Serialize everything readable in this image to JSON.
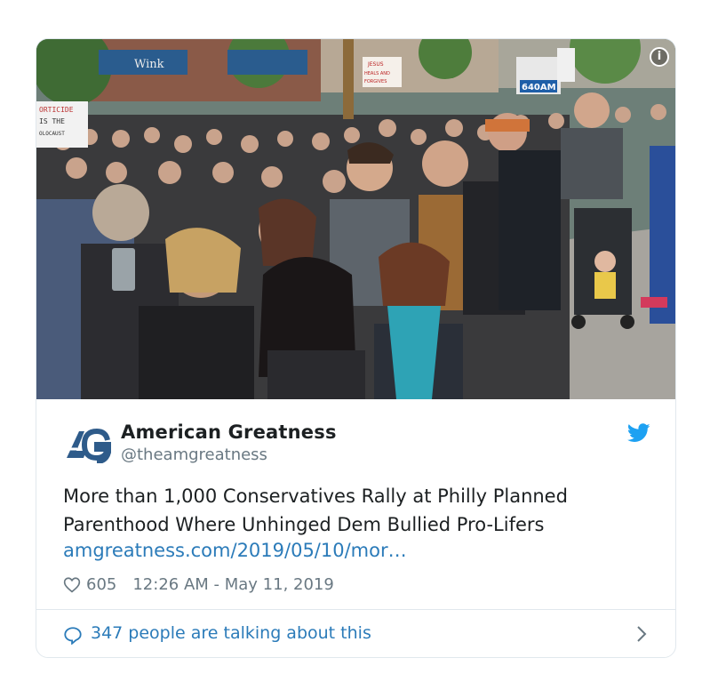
{
  "tweet": {
    "author_name": "American Greatness",
    "handle": "@theamgreatness",
    "text": "More than 1,000 Conservatives Rally at Philly Planned Parenthood Where Unhinged Dem Bullied Pro-Lifers",
    "link": "amgreatness.com/2019/05/10/mor…",
    "likes": "605",
    "timestamp": "12:26 AM - May 11, 2019",
    "talking": "347 people are talking about this"
  },
  "photo": {
    "signs": {
      "left_sign": "ORTICIDE\nIS THE\nOLOCAUST",
      "jesus_sign": "JESUS\nHEALS AND\nFORGIVES",
      "radio_sign": "640AM",
      "store_sign": "Wink"
    }
  },
  "icons": {
    "info": "info-icon",
    "logo": "american-greatness-logo",
    "twitter": "twitter-bird-icon",
    "heart": "heart-icon",
    "comment": "comment-bubble-icon",
    "chevron": "chevron-right-icon"
  },
  "colors": {
    "link": "#2b7bb9",
    "twitter_blue": "#1da1f2",
    "logo_blue": "#2e5b8a",
    "muted": "#697882"
  }
}
